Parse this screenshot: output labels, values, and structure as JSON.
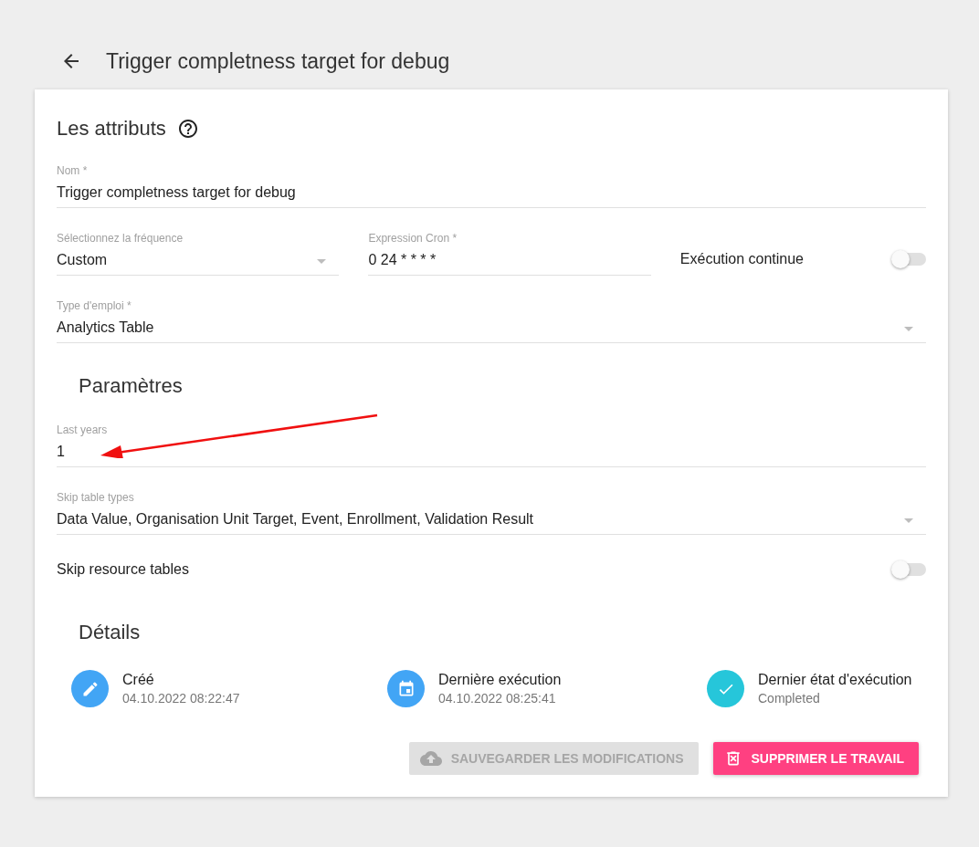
{
  "header": {
    "title": "Trigger completness target for debug"
  },
  "attributes": {
    "title": "Les attributs",
    "rows": [
      [
        {
          "kind": "text",
          "label": "Nom *",
          "value": "Trigger completness target for debug"
        }
      ],
      [
        {
          "kind": "select",
          "label": "Sélectionnez la fréquence",
          "value": "Custom"
        },
        {
          "kind": "text",
          "label": "Expression Cron *",
          "value": "0 24 * * * *"
        },
        {
          "kind": "toggle",
          "label": "Exécution continue",
          "on": false
        }
      ],
      [
        {
          "kind": "select",
          "label": "Type d'emploi *",
          "value": "Analytics Table"
        }
      ]
    ]
  },
  "parameters": {
    "title": "Paramètres",
    "rows": [
      [
        {
          "kind": "text",
          "label": "Last years",
          "value": "1",
          "pointed": true
        }
      ],
      [
        {
          "kind": "select",
          "label": "Skip table types",
          "value": "Data Value, Organisation Unit Target, Event, Enrollment, Validation Result"
        }
      ],
      [
        {
          "kind": "toggle",
          "label": "Skip resource tables",
          "on": false
        }
      ]
    ]
  },
  "details": {
    "title": "Détails",
    "items": [
      {
        "kind": "pencil",
        "color": "#42a5f5",
        "label": "Créé",
        "value": "04.10.2022 08:22:47"
      },
      {
        "kind": "calendar",
        "color": "#42a5f5",
        "label": "Dernière exécution",
        "value": "04.10.2022 08:25:41"
      },
      {
        "kind": "check",
        "color": "#26c6da",
        "label": "Dernier état d'exécution",
        "value": "Completed"
      }
    ]
  },
  "actions": [
    {
      "kind": "save",
      "label": "SAUVEGARDER LES MODIFICATIONS",
      "disabled": true
    },
    {
      "kind": "delete",
      "label": "SUPPRIMER LE TRAVAIL",
      "disabled": false
    }
  ]
}
